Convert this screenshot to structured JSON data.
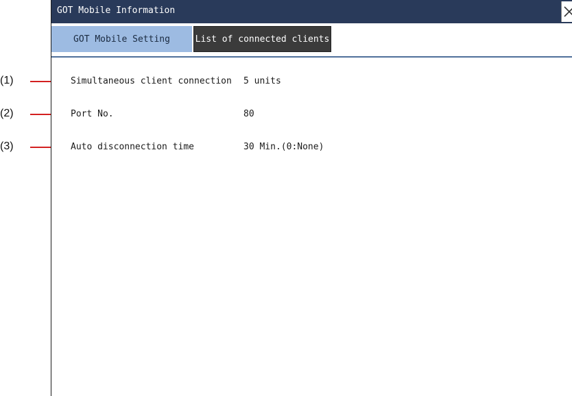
{
  "window": {
    "title": "GOT Mobile Information",
    "close_glyph": "×"
  },
  "tabs": [
    {
      "label": "GOT Mobile Setting",
      "active": true
    },
    {
      "label": "List of connected clients",
      "active": false
    }
  ],
  "settings": [
    {
      "callout": "(1)",
      "label": "Simultaneous client connection",
      "value": "5 units"
    },
    {
      "callout": "(2)",
      "label": "Port No.",
      "value": "80"
    },
    {
      "callout": "(3)",
      "label": "Auto disconnection time",
      "value": "30 Min.(0:None)"
    }
  ],
  "colors": {
    "titlebar": "#293a5a",
    "active_tab": "#9dbbe2",
    "inactive_tab": "#3b3b3b",
    "callout_line": "#d32020"
  },
  "icons": {
    "close": "close-icon"
  }
}
